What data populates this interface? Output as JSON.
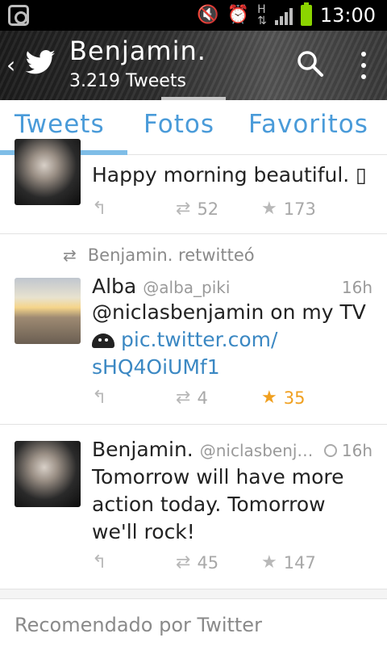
{
  "status_bar": {
    "time": "13:00",
    "icons": [
      "instagram-icon",
      "mute-icon",
      "alarm-icon",
      "data-icon",
      "signal-icon",
      "battery-icon"
    ],
    "battery_color": "#8bd400"
  },
  "header": {
    "name": "Benjamin.",
    "tweet_count": "3.219 Tweets"
  },
  "tabs": [
    {
      "label": "Tweets",
      "active": true
    },
    {
      "label": "Fotos",
      "active": false
    },
    {
      "label": "Favoritos",
      "active": false
    }
  ],
  "tweets": [
    {
      "text": "Happy morning beautiful. ▯",
      "retweets": "52",
      "favorites": "173"
    },
    {
      "context": "Benjamin. retwitteó",
      "name": "Alba",
      "handle": "@alba_piki",
      "time": "16h",
      "text_line1": "@niclasbenjamin on my TV",
      "link1": "pic.twitter.com/",
      "link2": "sHQ4OiUMf1",
      "retweets": "4",
      "favorites": "35",
      "favorited": true
    },
    {
      "name": "Benjamin.",
      "handle": "@niclasbenj…",
      "time": "16h",
      "text_line1": "Tomorrow will have more",
      "text_line2": "action today. Tomorrow",
      "text_line3": "we'll rock!",
      "retweets": "45",
      "favorites": "147"
    }
  ],
  "recommended": "Recomendado por Twitter",
  "colors": {
    "accent": "#4a9bd9",
    "link": "#3b88c3",
    "favorite_active": "#f0a020"
  }
}
